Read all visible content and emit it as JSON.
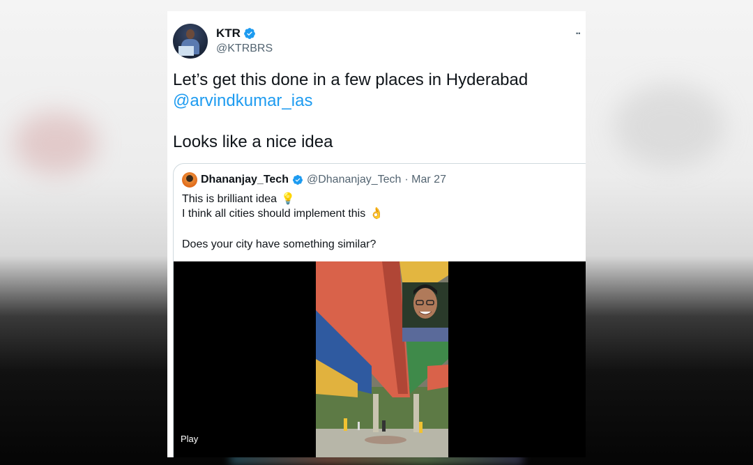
{
  "tweet": {
    "author": {
      "display_name": "KTR",
      "handle": "@KTRBRS"
    },
    "more_label": "··",
    "text_line1": "Let’s get this done in a few places in Hyderabad",
    "mention": "@arvindkumar_ias",
    "text_line2": "Looks like a nice idea"
  },
  "quoted_tweet": {
    "display_name": "Dhananjay_Tech",
    "handle": "@Dhananjay_Tech",
    "date": "· Mar 27",
    "line1": "This is brilliant idea",
    "emoji1": "💡",
    "line2": "I think all cities should implement this",
    "emoji2": "👌",
    "line3": "Does your city have something similar?",
    "media": {
      "play_label": "Play"
    }
  },
  "colors": {
    "verified": "#1d9bf0",
    "mention": "#1d9bf0",
    "text": "#0f1419",
    "secondary": "#536471"
  }
}
